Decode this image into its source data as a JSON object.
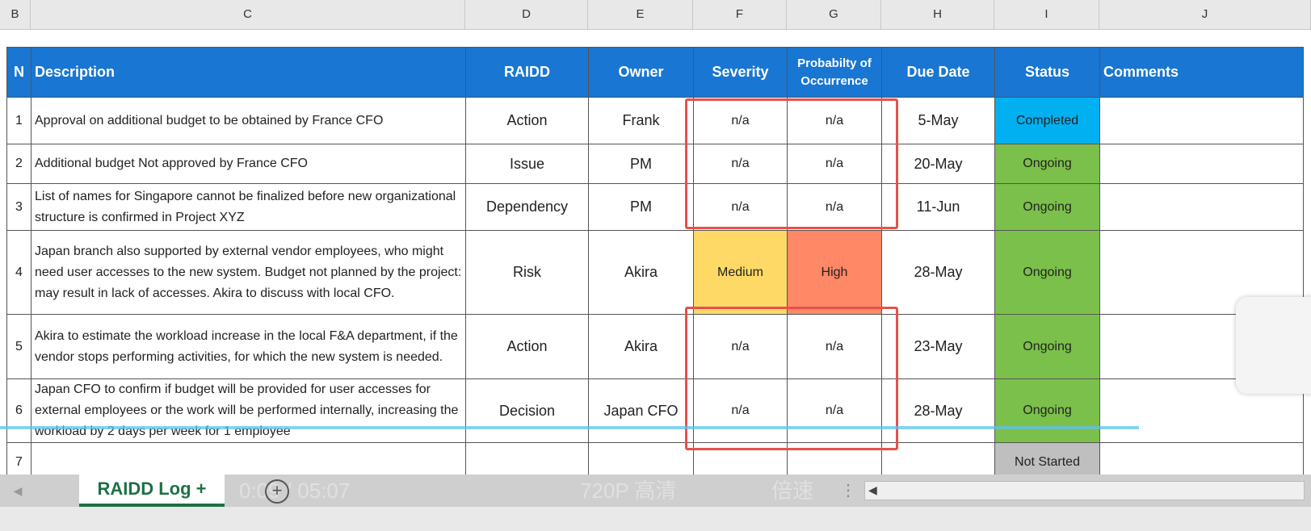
{
  "column_letters": [
    "B",
    "C",
    "D",
    "E",
    "F",
    "G",
    "H",
    "I",
    "J"
  ],
  "headers": {
    "n": "N",
    "description": "Description",
    "raidd": "RAIDD",
    "owner": "Owner",
    "severity": "Severity",
    "probability_line1": "Probabilty of",
    "probability_line2": "Occurrence",
    "due_date": "Due Date",
    "status": "Status",
    "comments": "Comments"
  },
  "rows": [
    {
      "n": "1",
      "description": "Approval on additional budget to be obtained by France CFO",
      "raidd": "Action",
      "owner": "Frank",
      "severity": "n/a",
      "probability": "n/a",
      "due": "5-May",
      "status": "Completed",
      "comments": ""
    },
    {
      "n": "2",
      "description": "Additional budget Not approved by France CFO",
      "raidd": "Issue",
      "owner": "PM",
      "severity": "n/a",
      "probability": "n/a",
      "due": "20-May",
      "status": "Ongoing",
      "comments": ""
    },
    {
      "n": "3",
      "description": "List of names for Singapore cannot be finalized before new organizational structure is confirmed in Project XYZ",
      "raidd": "Dependency",
      "owner": "PM",
      "severity": "n/a",
      "probability": "n/a",
      "due": "11-Jun",
      "status": "Ongoing",
      "comments": ""
    },
    {
      "n": "4",
      "description": "Japan branch also supported by external vendor employees, who might need user accesses to the new system. Budget not planned by the project: may result in lack of accesses. Akira to discuss with local CFO.",
      "raidd": "Risk",
      "owner": "Akira",
      "severity": "Medium",
      "probability": "High",
      "due": "28-May",
      "status": "Ongoing",
      "comments": ""
    },
    {
      "n": "5",
      "description": "Akira to estimate the workload increase in the local F&A department, if the vendor stops performing activities, for which the new system is needed.",
      "raidd": "Action",
      "owner": "Akira",
      "severity": "n/a",
      "probability": "n/a",
      "due": "23-May",
      "status": "Ongoing",
      "comments": ""
    },
    {
      "n": "6",
      "description": "Japan CFO to confirm if budget will be provided for user accesses for external employees or the work will be performed internally, increasing the workload by 2 days per week for 1 employee",
      "raidd": "Decision",
      "owner": "Japan CFO",
      "severity": "n/a",
      "probability": "n/a",
      "due": "28-May",
      "status": "Ongoing",
      "comments": ""
    },
    {
      "n": "7",
      "description": "",
      "raidd": "",
      "owner": "",
      "severity": "",
      "probability": "",
      "due": "",
      "status": "Not Started",
      "comments": ""
    }
  ],
  "colors": {
    "header_blue": "#1976d2",
    "completed": "#00b0f0",
    "ongoing": "#7bc04a",
    "not_started": "#bfbfbf",
    "medium": "#ffd966",
    "high": "#ff8866",
    "annotation_red": "#e8504a"
  },
  "sheet_tab": "RAIDD Log +",
  "overlay": {
    "time": "0:09 / 05:07",
    "quality": "720P 高清",
    "speed": "倍速"
  },
  "icons": {
    "add_sheet": "plus-circle-icon",
    "scroll_left": "arrow-left-icon",
    "tab_nav": "nav-left-icon"
  }
}
